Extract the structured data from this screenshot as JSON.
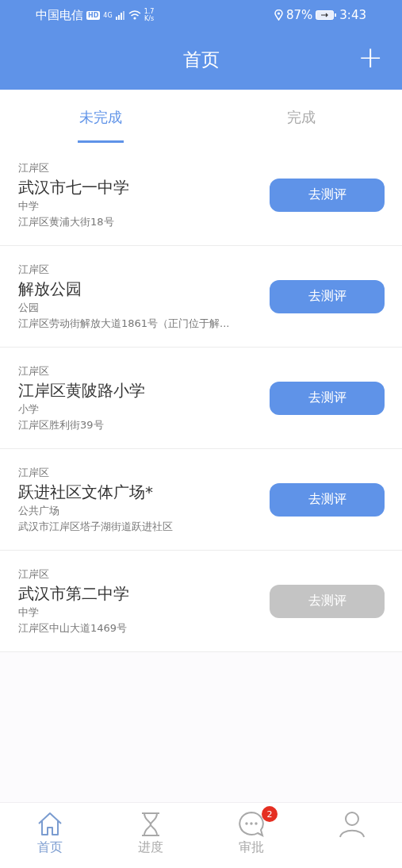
{
  "status_bar": {
    "carrier": "中国电信",
    "hd": "HD",
    "network": "4G",
    "speed": "1.7",
    "speed_unit": "K/s",
    "battery": "87%",
    "time": "3:43"
  },
  "header": {
    "title": "首页",
    "add": "+"
  },
  "tabs": [
    {
      "label": "未完成",
      "selected": true
    },
    {
      "label": "完成",
      "selected": false
    }
  ],
  "items": [
    {
      "district": "江岸区",
      "name": "武汉市七一中学",
      "type": "中学",
      "address": "江岸区黄浦大街18号",
      "button": "去测评",
      "disabled": false
    },
    {
      "district": "江岸区",
      "name": "解放公园",
      "type": "公园",
      "address": "江岸区劳动街解放大道1861号（正门位于解...",
      "button": "去测评",
      "disabled": false
    },
    {
      "district": "江岸区",
      "name": "江岸区黄陂路小学",
      "type": "小学",
      "address": "江岸区胜利街39号",
      "button": "去测评",
      "disabled": false
    },
    {
      "district": "江岸区",
      "name": "跃进社区文体广场*",
      "type": "公共广场",
      "address": "武汉市江岸区塔子湖街道跃进社区",
      "button": "去测评",
      "disabled": false
    },
    {
      "district": "江岸区",
      "name": "武汉市第二中学",
      "type": "中学",
      "address": "江岸区中山大道1469号",
      "button": "去测评",
      "disabled": true
    }
  ],
  "bottom_nav": [
    {
      "kind": "home",
      "label": "首页",
      "selected": true
    },
    {
      "kind": "progress",
      "label": "进度",
      "selected": false
    },
    {
      "kind": "approve",
      "label": "审批",
      "selected": false,
      "badge": "2"
    },
    {
      "kind": "profile",
      "selected": false
    }
  ]
}
